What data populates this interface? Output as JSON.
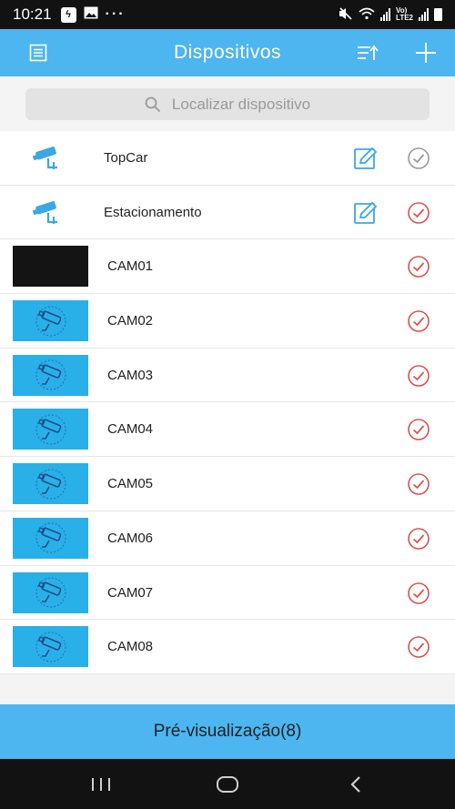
{
  "status_bar": {
    "time": "10:21",
    "dots": "···",
    "network_label": "Vo)\nLTE2",
    "icons": [
      "messenger-icon",
      "image-icon",
      "mute-icon",
      "wifi-icon",
      "signal-icon",
      "battery-icon"
    ]
  },
  "app_bar": {
    "title": "Dispositivos",
    "left_icon": "list-icon",
    "right_icons": [
      "sort-icon",
      "add-icon"
    ]
  },
  "search": {
    "placeholder": "Localizar dispositivo"
  },
  "devices": [
    {
      "name": "TopCar",
      "icon": "camera-icon",
      "edit": true,
      "checked": false
    },
    {
      "name": "Estacionamento",
      "icon": "camera-icon",
      "edit": true,
      "checked": true
    }
  ],
  "channels": [
    {
      "name": "CAM01",
      "thumb": "black",
      "checked": true
    },
    {
      "name": "CAM02",
      "thumb": "blue",
      "checked": true
    },
    {
      "name": "CAM03",
      "thumb": "blue",
      "checked": true
    },
    {
      "name": "CAM04",
      "thumb": "blue",
      "checked": true
    },
    {
      "name": "CAM05",
      "thumb": "blue",
      "checked": true
    },
    {
      "name": "CAM06",
      "thumb": "blue",
      "checked": true
    },
    {
      "name": "CAM07",
      "thumb": "blue",
      "checked": true
    },
    {
      "name": "CAM08",
      "thumb": "blue",
      "checked": true
    }
  ],
  "preview_button": {
    "label": "Pré-visualização(8)"
  },
  "colors": {
    "accent": "#4db5f0",
    "check_on": "#d9534f",
    "check_off": "#9a9a9a",
    "thumb_blue": "#29b0e8"
  }
}
